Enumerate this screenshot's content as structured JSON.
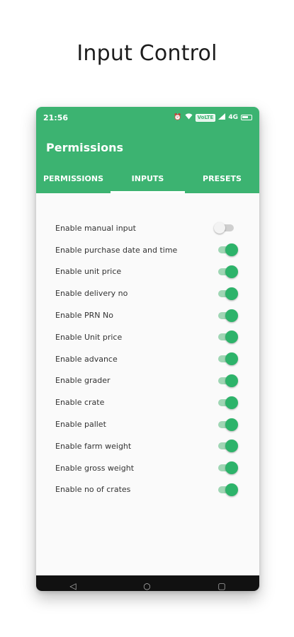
{
  "headline": "Input Control",
  "status": {
    "time": "21:56",
    "volte_label": "VoLTE",
    "network_label": "4G"
  },
  "appbar": {
    "title": "Permissions"
  },
  "tabs": [
    {
      "label": "PERMISSIONS",
      "active": false
    },
    {
      "label": "INPUTS",
      "active": true
    },
    {
      "label": "PRESETS",
      "active": false
    }
  ],
  "settings": [
    {
      "label": "Enable manual input",
      "enabled": false
    },
    {
      "label": "Enable purchase date and time",
      "enabled": true
    },
    {
      "label": "Enable unit price",
      "enabled": true
    },
    {
      "label": "Enable delivery no",
      "enabled": true
    },
    {
      "label": "Enable PRN No",
      "enabled": true
    },
    {
      "label": "Enable Unit price",
      "enabled": true
    },
    {
      "label": "Enable advance",
      "enabled": true
    },
    {
      "label": "Enable grader",
      "enabled": true
    },
    {
      "label": "Enable crate",
      "enabled": true
    },
    {
      "label": "Enable pallet",
      "enabled": true
    },
    {
      "label": "Enable farm weight",
      "enabled": true
    },
    {
      "label": "Enable gross weight",
      "enabled": true
    },
    {
      "label": "Enable no of crates",
      "enabled": true
    }
  ],
  "colors": {
    "accent": "#3cb371",
    "switch_on": "#2db36a"
  },
  "icons": [
    "alarm-icon",
    "wifi-icon",
    "signal-icon",
    "battery-icon",
    "back-icon",
    "home-icon",
    "recents-icon"
  ]
}
